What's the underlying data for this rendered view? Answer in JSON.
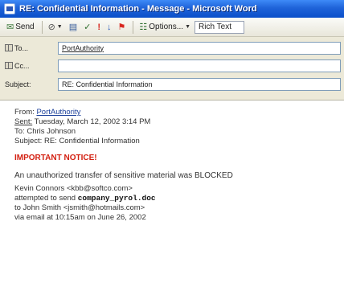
{
  "window": {
    "title": "RE: Confidential Information - Message - Microsoft Word"
  },
  "toolbar": {
    "send_label": "Send",
    "options_label": "Options...",
    "format_value": "Rich Text",
    "icons": [
      "send-icon",
      "attach-icon",
      "address-book-icon",
      "check-names-icon",
      "high-importance-icon",
      "low-importance-icon",
      "flag-icon",
      "options-icon"
    ]
  },
  "fields": {
    "to_label": "To...",
    "to_value": "PortAuthority",
    "cc_label": "Cc...",
    "cc_value": "",
    "subject_label": "Subject:",
    "subject_value": "RE: Confidential Information"
  },
  "message": {
    "from_label": "From:",
    "from_value": "PortAuthority",
    "sent_label": "Sent:",
    "sent_value": "Tuesday, March 12, 2002 3:14 PM",
    "to_label": "To:",
    "to_value": "Chris Johnson",
    "subject_label": "Subject:",
    "subject_value": "RE: Confidential Information",
    "notice": "IMPORTANT NOTICE!",
    "alert": "An unauthorized transfer of sensitive material was BLOCKED",
    "sender": "Kevin Connors <kbb@softco.com>",
    "attempt_prefix": "attempted to send",
    "filename": "company_pyrol.doc",
    "recipient": "to John Smith <jsmith@hotmails.com>",
    "via": "via email at 10:15am on June 26, 2002"
  },
  "colors": {
    "title_bar": "#0a4fc9",
    "notice": "#d32011",
    "link": "#1a3f9a"
  }
}
